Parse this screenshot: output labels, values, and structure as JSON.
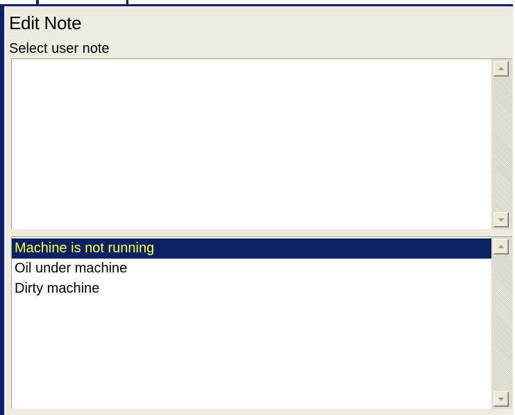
{
  "dialog": {
    "title": "Edit Note",
    "subtitle": "Select user note",
    "note_text": ""
  },
  "notes_list": {
    "items": [
      {
        "label": "Machine is not running",
        "selected": true
      },
      {
        "label": "Oil under machine",
        "selected": false
      },
      {
        "label": "Dirty machine",
        "selected": false
      }
    ]
  },
  "colors": {
    "frame_border": "#0b1f6e",
    "dialog_background": "#edebe0",
    "selection_background": "#0b2262",
    "selection_text": "#ffff44"
  },
  "icons": {
    "scroll_up": "up-arrow-icon",
    "scroll_down": "down-arrow-icon"
  }
}
